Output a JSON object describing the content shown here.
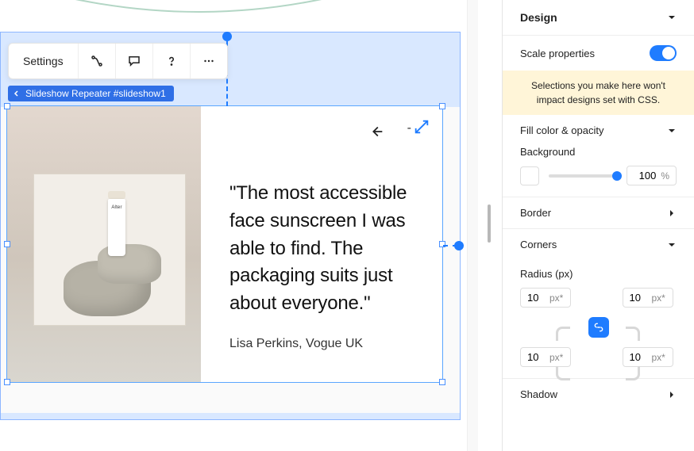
{
  "toolbar": {
    "settings_label": "Settings",
    "icons": {
      "animation": "animation-icon",
      "comment": "comment-icon",
      "help": "help-icon",
      "more": "more-icon"
    }
  },
  "selection_tag": {
    "label": "Slideshow Repeater #slideshow1"
  },
  "slide": {
    "quote_text": "\"The most accessible face sunscreen I was able to find. The packaging suits just about everyone.\"",
    "byline": "Lisa Perkins, Vogue UK",
    "resize_label": "-"
  },
  "panel": {
    "design_label": "Design",
    "scale_props_label": "Scale properties",
    "scale_props_on": true,
    "css_notice": "Selections you make here won't impact designs set with CSS.",
    "fill_label": "Fill color & opacity",
    "background_label": "Background",
    "opacity": {
      "value": "100",
      "unit": "%"
    },
    "border_label": "Border",
    "corners_label": "Corners",
    "radius_label": "Radius (px)",
    "radius": {
      "tl": {
        "value": "10",
        "unit": "px*"
      },
      "tr": {
        "value": "10",
        "unit": "px*"
      },
      "bl": {
        "value": "10",
        "unit": "px*"
      },
      "br": {
        "value": "10",
        "unit": "px*"
      }
    },
    "shadow_label": "Shadow"
  }
}
